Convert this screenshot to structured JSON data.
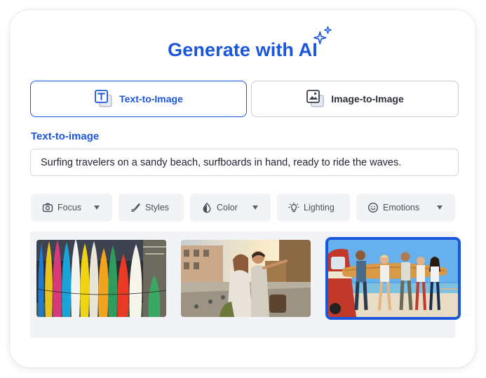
{
  "header": {
    "title": "Generate with AI",
    "sparkle_icon": "sparkles-icon",
    "accent": "#1a56db"
  },
  "tabs": [
    {
      "label": "Text-to-Image",
      "icon": "text-to-image-icon",
      "active": true
    },
    {
      "label": "Image-to-Image",
      "icon": "image-to-image-icon",
      "active": false
    }
  ],
  "prompt": {
    "label": "Text-to-image",
    "value": "Surfing travelers on a sandy beach, surfboards in hand, ready to ride the waves."
  },
  "filters": [
    {
      "label": "Focus",
      "icon": "camera-icon",
      "dropdown": true
    },
    {
      "label": "Styles",
      "icon": "brush-icon",
      "dropdown": false
    },
    {
      "label": "Color",
      "icon": "droplet-icon",
      "dropdown": true
    },
    {
      "label": "Lighting",
      "icon": "lightbulb-icon",
      "dropdown": false
    },
    {
      "label": "Emotions",
      "icon": "smiley-icon",
      "dropdown": true
    }
  ],
  "results": [
    {
      "name": "colorful-surfboards-image",
      "selected": false
    },
    {
      "name": "travel-couple-street-image",
      "selected": false
    },
    {
      "name": "surfers-carrying-board-image",
      "selected": true
    }
  ]
}
